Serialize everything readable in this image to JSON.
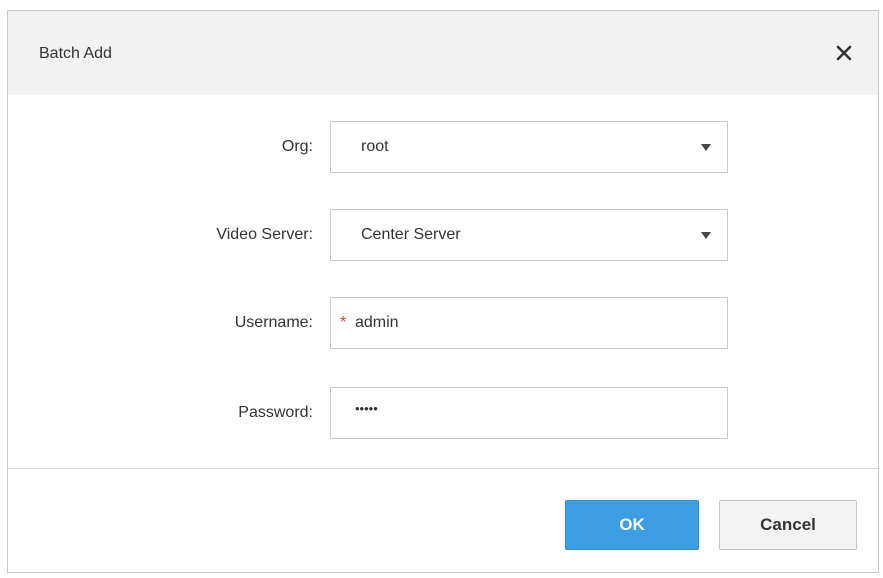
{
  "dialog": {
    "title": "Batch Add",
    "close_icon": "close-icon"
  },
  "form": {
    "org": {
      "label": "Org:",
      "value": "root"
    },
    "video_server": {
      "label": "Video Server:",
      "value": "Center Server"
    },
    "username": {
      "label": "Username:",
      "required_mark": "*",
      "value": "admin"
    },
    "password": {
      "label": "Password:",
      "masked_value": "•••••"
    }
  },
  "footer": {
    "ok_label": "OK",
    "cancel_label": "Cancel"
  },
  "colors": {
    "primary": "#3c9ee0",
    "required": "#e23b3b",
    "header_bg": "#f2f2f2"
  }
}
